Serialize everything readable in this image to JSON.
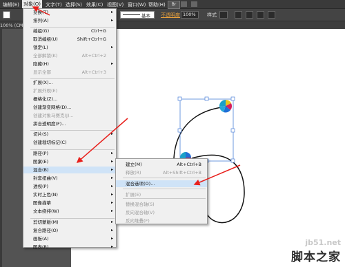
{
  "menubar": {
    "items": [
      "编辑(E)",
      "对象(O)",
      "文字(T)",
      "选择(S)",
      "效果(C)",
      "视图(V)",
      "窗口(W)",
      "帮助(H)"
    ],
    "logo": "Br"
  },
  "optbar": {
    "stroke_style": "基本",
    "opacity_label": "不透明度",
    "opacity_value": "100%",
    "style_label": "样式"
  },
  "tab": {
    "label": "100% (CM"
  },
  "object_menu": {
    "items": [
      {
        "label": "变换(T)",
        "shortcut": "",
        "arrow": true,
        "disabled": false
      },
      {
        "label": "排列(A)",
        "shortcut": "",
        "arrow": true,
        "disabled": false
      },
      {
        "label": "编组(G)",
        "shortcut": "Ctrl+G",
        "arrow": false,
        "disabled": false
      },
      {
        "label": "取消编组(U)",
        "shortcut": "Shift+Ctrl+G",
        "arrow": false,
        "disabled": false
      },
      {
        "label": "锁定(L)",
        "shortcut": "",
        "arrow": true,
        "disabled": false
      },
      {
        "label": "全部解锁(K)",
        "shortcut": "Alt+Ctrl+2",
        "arrow": false,
        "disabled": true
      },
      {
        "label": "隐藏(H)",
        "shortcut": "",
        "arrow": true,
        "disabled": false
      },
      {
        "label": "显示全部",
        "shortcut": "Alt+Ctrl+3",
        "arrow": false,
        "disabled": true
      },
      {
        "label": "扩展(X)...",
        "shortcut": "",
        "arrow": false,
        "disabled": false
      },
      {
        "label": "扩展外观(E)",
        "shortcut": "",
        "arrow": false,
        "disabled": true
      },
      {
        "label": "栅格化(Z)...",
        "shortcut": "",
        "arrow": false,
        "disabled": false
      },
      {
        "label": "创建渐变网格(D)...",
        "shortcut": "",
        "arrow": false,
        "disabled": false
      },
      {
        "label": "创建对象马赛克(J)...",
        "shortcut": "",
        "arrow": false,
        "disabled": true
      },
      {
        "label": "拼合透明度(F)...",
        "shortcut": "",
        "arrow": false,
        "disabled": false
      },
      {
        "label": "切片(S)",
        "shortcut": "",
        "arrow": true,
        "disabled": false
      },
      {
        "label": "创建裁切标记(C)",
        "shortcut": "",
        "arrow": false,
        "disabled": false
      },
      {
        "label": "路径(P)",
        "shortcut": "",
        "arrow": true,
        "disabled": false
      },
      {
        "label": "图案(E)",
        "shortcut": "",
        "arrow": true,
        "disabled": false
      },
      {
        "label": "混合(B)",
        "shortcut": "",
        "arrow": true,
        "disabled": false
      },
      {
        "label": "封套扭曲(V)",
        "shortcut": "",
        "arrow": true,
        "disabled": false
      },
      {
        "label": "透视(P)",
        "shortcut": "",
        "arrow": true,
        "disabled": false
      },
      {
        "label": "实时上色(N)",
        "shortcut": "",
        "arrow": true,
        "disabled": false
      },
      {
        "label": "图像描摹",
        "shortcut": "",
        "arrow": true,
        "disabled": false
      },
      {
        "label": "文本绕排(W)",
        "shortcut": "",
        "arrow": true,
        "disabled": false
      },
      {
        "label": "剪切蒙版(M)",
        "shortcut": "",
        "arrow": true,
        "disabled": false
      },
      {
        "label": "复合路径(O)",
        "shortcut": "",
        "arrow": true,
        "disabled": false
      },
      {
        "label": "画板(A)",
        "shortcut": "",
        "arrow": true,
        "disabled": false
      },
      {
        "label": "图表(R)",
        "shortcut": "",
        "arrow": true,
        "disabled": false
      }
    ]
  },
  "blend_menu": {
    "items": [
      {
        "label": "建立(M)",
        "shortcut": "Alt+Ctrl+B",
        "disabled": false
      },
      {
        "label": "释放(R)",
        "shortcut": "Alt+Shift+Ctrl+B",
        "disabled": true
      },
      {
        "label": "混合选项(O)...",
        "shortcut": "",
        "disabled": false
      },
      {
        "label": "扩展(E)",
        "shortcut": "",
        "disabled": true
      },
      {
        "label": "替换混合轴(S)",
        "shortcut": "",
        "disabled": true
      },
      {
        "label": "反向混合轴(V)",
        "shortcut": "",
        "disabled": true
      },
      {
        "label": "反向堆叠(F)",
        "shortcut": "",
        "disabled": true
      }
    ]
  },
  "watermark": {
    "line1": "jb51.net",
    "line2": "脚本之家"
  },
  "colors": {
    "arrow": "#e8201c",
    "selection": "#4a7fd8",
    "highlight": "#cfe3f7"
  }
}
